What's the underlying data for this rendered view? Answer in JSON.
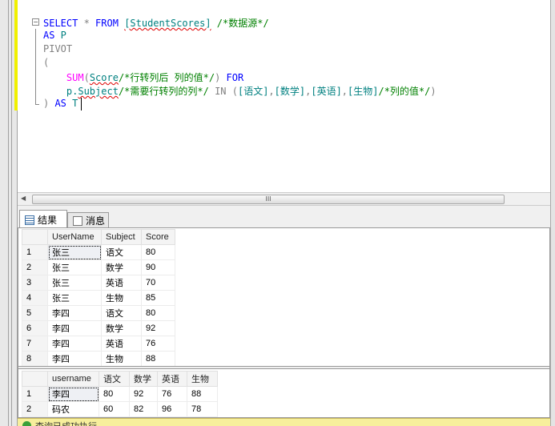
{
  "editor": {
    "lines": [
      {
        "tokens": [
          {
            "t": "SELECT",
            "c": "kw"
          },
          {
            "t": " * ",
            "c": "gr"
          },
          {
            "t": "FROM",
            "c": "kw"
          },
          {
            "t": " ",
            "c": ""
          },
          {
            "t": "[StudentScores]",
            "c": "id sq"
          },
          {
            "t": " /*",
            "c": "cm"
          },
          {
            "t": "数据源",
            "c": "cm"
          },
          {
            "t": "*/",
            "c": "cm"
          }
        ]
      },
      {
        "tokens": [
          {
            "t": "AS",
            "c": "kw"
          },
          {
            "t": " P",
            "c": "id"
          }
        ]
      },
      {
        "tokens": [
          {
            "t": "PIVOT",
            "c": "gr"
          }
        ]
      },
      {
        "tokens": [
          {
            "t": "(",
            "c": "gr"
          }
        ]
      },
      {
        "tokens": [
          {
            "t": "    ",
            "c": ""
          },
          {
            "t": "SUM",
            "c": "fn"
          },
          {
            "t": "(",
            "c": "gr"
          },
          {
            "t": "Score",
            "c": "id sq"
          },
          {
            "t": "/*行转列后 列的值*/",
            "c": "cm"
          },
          {
            "t": ")",
            "c": "gr"
          },
          {
            "t": " FOR",
            "c": "kw"
          }
        ]
      },
      {
        "tokens": [
          {
            "t": "    ",
            "c": ""
          },
          {
            "t": "p.",
            "c": "id"
          },
          {
            "t": "Subject",
            "c": "id sq"
          },
          {
            "t": "/*需要行转列的列*/",
            "c": "cm"
          },
          {
            "t": " IN (",
            "c": "gr"
          },
          {
            "t": "[语文]",
            "c": "id"
          },
          {
            "t": ",",
            "c": "gr"
          },
          {
            "t": "[数学]",
            "c": "id"
          },
          {
            "t": ",",
            "c": "gr"
          },
          {
            "t": "[英语]",
            "c": "id"
          },
          {
            "t": ",",
            "c": "gr"
          },
          {
            "t": "[生物]",
            "c": "id"
          },
          {
            "t": "/*列的值*/",
            "c": "cm"
          },
          {
            "t": ")",
            "c": "gr"
          }
        ]
      },
      {
        "tokens": [
          {
            "t": ")",
            "c": "gr"
          },
          {
            "t": " AS",
            "c": "kw"
          },
          {
            "t": " T",
            "c": "id"
          }
        ]
      }
    ],
    "scroll_thumb_label": "III"
  },
  "tabs": [
    {
      "label": "结果",
      "icon": "grid-icon",
      "active": true
    },
    {
      "label": "消息",
      "icon": "message-icon",
      "active": false
    }
  ],
  "grid1": {
    "columns": [
      "UserName",
      "Subject",
      "Score"
    ],
    "rows": [
      [
        "张三",
        "语文",
        "80"
      ],
      [
        "张三",
        "数学",
        "90"
      ],
      [
        "张三",
        "英语",
        "70"
      ],
      [
        "张三",
        "生物",
        "85"
      ],
      [
        "李四",
        "语文",
        "80"
      ],
      [
        "李四",
        "数学",
        "92"
      ],
      [
        "李四",
        "英语",
        "76"
      ],
      [
        "李四",
        "生物",
        "88"
      ]
    ]
  },
  "grid2": {
    "columns": [
      "username",
      "语文",
      "数学",
      "英语",
      "生物"
    ],
    "rows": [
      [
        "李四",
        "80",
        "92",
        "76",
        "88"
      ],
      [
        "码农",
        "60",
        "82",
        "96",
        "78"
      ]
    ]
  },
  "status": {
    "text": "查询已成功执行。",
    "color": "#f7ef9c"
  }
}
